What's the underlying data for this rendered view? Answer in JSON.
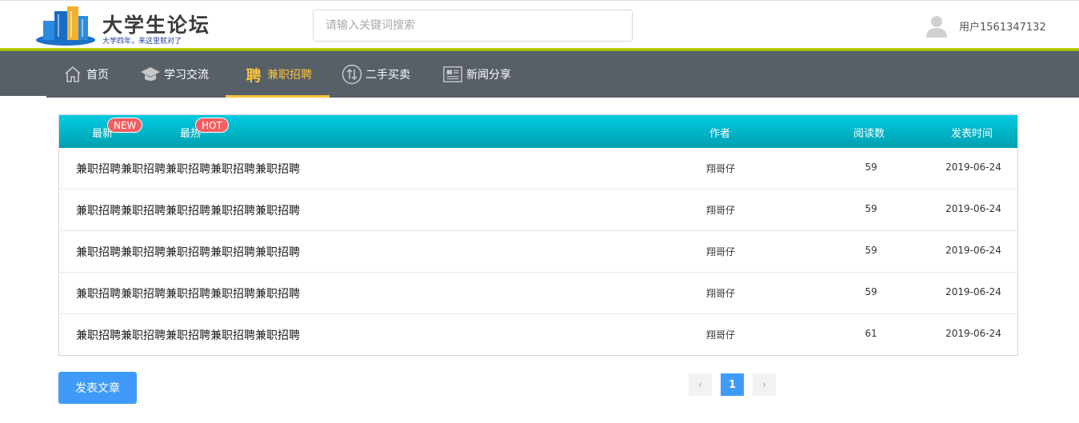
{
  "header": {
    "site_title": "大学生论坛",
    "site_slogan": "大学四年，来这里就对了",
    "search_placeholder": "请输入关键词搜索",
    "username": "用户1561347132"
  },
  "nav": {
    "items": [
      {
        "label": "首页",
        "icon": "home-icon"
      },
      {
        "label": "学习交流",
        "icon": "graduation-cap-icon"
      },
      {
        "label": "兼职招聘",
        "icon": "job-icon",
        "glyph": "聘",
        "active": true
      },
      {
        "label": "二手买卖",
        "icon": "exchange-icon"
      },
      {
        "label": "新闻分享",
        "icon": "newspaper-icon"
      }
    ]
  },
  "table": {
    "tabs": [
      {
        "label": "最新",
        "badge": "NEW"
      },
      {
        "label": "最热",
        "badge": "HOT"
      }
    ],
    "columns": {
      "author": "作者",
      "views": "阅读数",
      "date": "发表时间"
    },
    "rows": [
      {
        "title": "兼职招聘兼职招聘兼职招聘兼职招聘兼职招聘",
        "author": "翔哥仔",
        "views": "59",
        "date": "2019-06-24"
      },
      {
        "title": "兼职招聘兼职招聘兼职招聘兼职招聘兼职招聘",
        "author": "翔哥仔",
        "views": "59",
        "date": "2019-06-24"
      },
      {
        "title": "兼职招聘兼职招聘兼职招聘兼职招聘兼职招聘",
        "author": "翔哥仔",
        "views": "59",
        "date": "2019-06-24"
      },
      {
        "title": "兼职招聘兼职招聘兼职招聘兼职招聘兼职招聘",
        "author": "翔哥仔",
        "views": "59",
        "date": "2019-06-24"
      },
      {
        "title": "兼职招聘兼职招聘兼职招聘兼职招聘兼职招聘",
        "author": "翔哥仔",
        "views": "61",
        "date": "2019-06-24"
      }
    ]
  },
  "footer": {
    "post_button": "发表文章",
    "pager": {
      "prev": "‹",
      "current": "1",
      "next": "›"
    }
  },
  "colors": {
    "nav_bg": "#575f67",
    "nav_active": "#f7c23c",
    "table_header": "#00b5c8",
    "primary": "#3f9bf7",
    "badge": "#f15f62"
  }
}
